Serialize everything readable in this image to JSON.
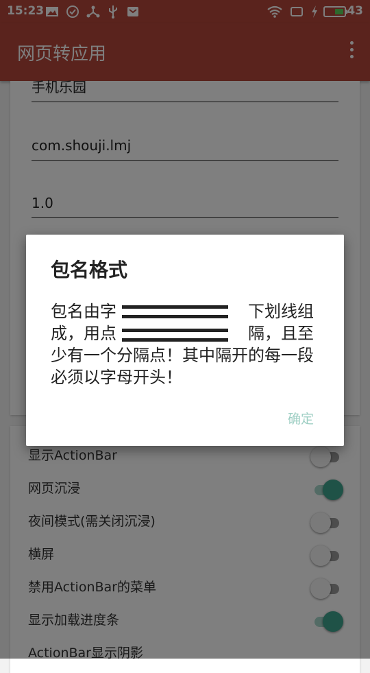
{
  "status_bar": {
    "time": "15:23",
    "battery": "43",
    "icons": [
      "gallery-icon",
      "check-circle-icon",
      "network-icon",
      "usb-icon",
      "mail-icon",
      "wifi-icon",
      "screen-icon",
      "charging-icon",
      "battery-icon"
    ]
  },
  "app_bar": {
    "title": "网页转应用",
    "menu_icon": "more-vert-icon"
  },
  "fields": [
    {
      "value": "手机乐园"
    },
    {
      "value": "com.shouji.lmj"
    },
    {
      "value": "1.0"
    }
  ],
  "settings": [
    {
      "label": "显示ActionBar",
      "on": false
    },
    {
      "label": "网页沉浸",
      "on": true
    },
    {
      "label": "夜间模式(需关闭沉浸)",
      "on": false
    },
    {
      "label": "横屏",
      "on": false
    },
    {
      "label": "禁用ActionBar的菜单",
      "on": false
    },
    {
      "label": "显示加载进度条",
      "on": true
    },
    {
      "label": "ActionBar显示阴影",
      "on": false
    }
  ],
  "dialog": {
    "title": "包名格式",
    "message": "包名由字　　　　　　　　下划线组成，用点　　　　　　　　隔，且至少有一个分隔点！其中隔开的每一段必须以字母开头！",
    "ok_label": "确定"
  },
  "colors": {
    "primary": "#b5473a",
    "accent": "#3ea58e",
    "ok_text": "#9fcfc4"
  }
}
